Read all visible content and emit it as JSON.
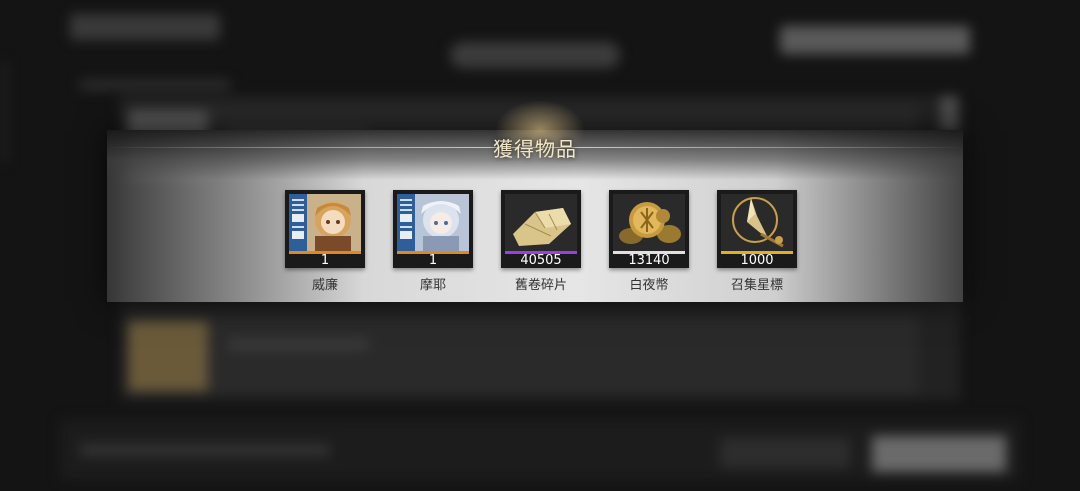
{
  "popup": {
    "title": "獲得物品",
    "items": [
      {
        "name": "威廉",
        "quantity": "1",
        "icon": "character-card-icon",
        "rarity_color": "#e08a1e"
      },
      {
        "name": "摩耶",
        "quantity": "1",
        "icon": "character-card-icon",
        "rarity_color": "#e08a1e"
      },
      {
        "name": "舊卷碎片",
        "quantity": "40505",
        "icon": "scroll-fragment-icon",
        "rarity_color": "#9b3fe0"
      },
      {
        "name": "白夜幣",
        "quantity": "13140",
        "icon": "coins-icon",
        "rarity_color": "#e0e0e0"
      },
      {
        "name": "召集星標",
        "quantity": "1000",
        "icon": "star-spear-icon",
        "rarity_color": "#e0b01e"
      }
    ]
  }
}
